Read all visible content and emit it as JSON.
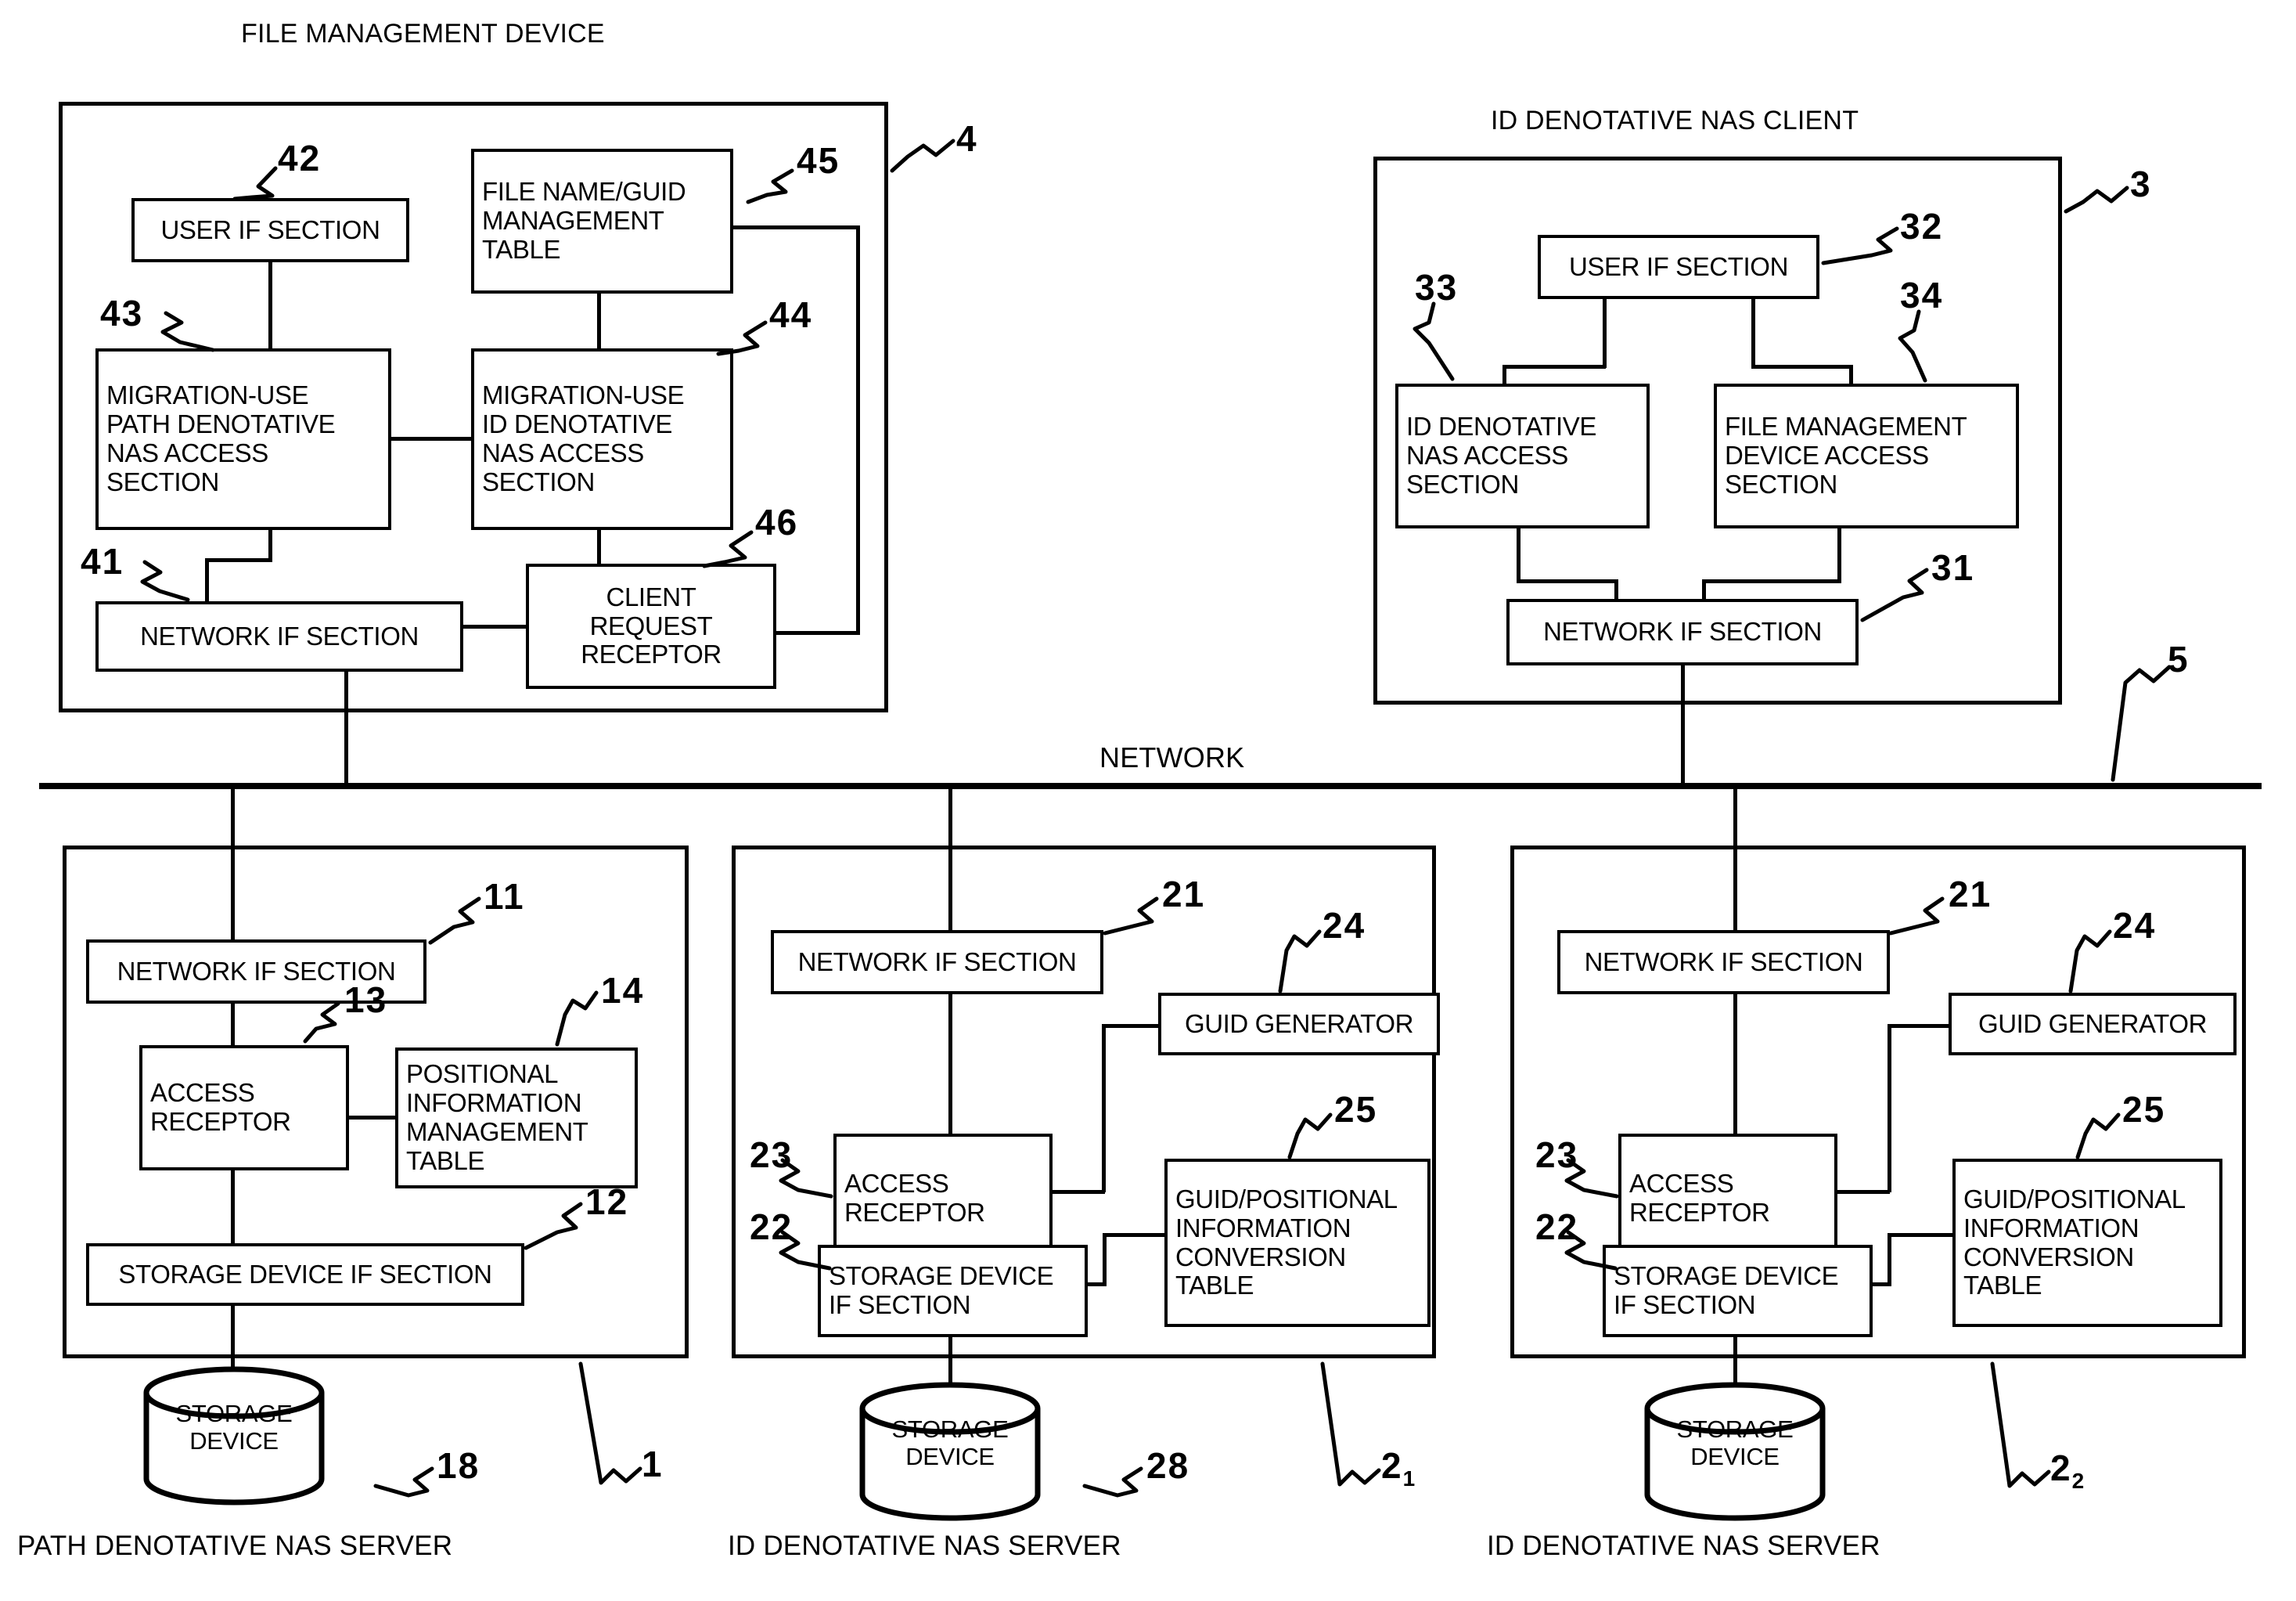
{
  "figure": {
    "groups": {
      "file_management_device": {
        "title": "FILE MANAGEMENT DEVICE",
        "ref": "4",
        "blocks": {
          "user_if": {
            "label": "USER IF SECTION",
            "ref": "42"
          },
          "file_name_guid_table": {
            "label": "FILE NAME/GUID\nMANAGEMENT\nTABLE",
            "ref": "45"
          },
          "migration_path_nas": {
            "label": "MIGRATION-USE\nPATH DENOTATIVE\nNAS ACCESS\nSECTION",
            "ref": "43"
          },
          "migration_id_nas": {
            "label": "MIGRATION-USE\nID DENOTATIVE\nNAS ACCESS\nSECTION",
            "ref": "44"
          },
          "network_if": {
            "label": "NETWORK IF SECTION",
            "ref": "41"
          },
          "client_request_receptor": {
            "label": "CLIENT\nREQUEST\nRECEPTOR",
            "ref": "46"
          }
        }
      },
      "id_denotative_nas_client": {
        "title": "ID DENOTATIVE NAS CLIENT",
        "ref": "3",
        "blocks": {
          "user_if": {
            "label": "USER IF SECTION",
            "ref": "32"
          },
          "id_nas_access": {
            "label": "ID DENOTATIVE\nNAS ACCESS\nSECTION",
            "ref": "33"
          },
          "file_mgmt_device_access": {
            "label": "FILE MANAGEMENT\nDEVICE ACCESS\nSECTION",
            "ref": "34"
          },
          "network_if": {
            "label": "NETWORK IF SECTION",
            "ref": "31"
          }
        }
      },
      "path_denotative_nas_server": {
        "caption": "PATH DENOTATIVE NAS SERVER",
        "ref": "1",
        "blocks": {
          "network_if": {
            "label": "NETWORK IF SECTION",
            "ref": "11"
          },
          "access_receptor": {
            "label": "ACCESS\nRECEPTOR",
            "ref": "13"
          },
          "positional_info_table": {
            "label": "POSITIONAL\nINFORMATION\nMANAGEMENT\nTABLE",
            "ref": "14"
          },
          "storage_device_if": {
            "label": "STORAGE DEVICE IF SECTION",
            "ref": "12"
          },
          "storage_device": {
            "label": "STORAGE\nDEVICE",
            "ref": "18"
          }
        }
      },
      "id_denotative_nas_server_1": {
        "caption": "ID DENOTATIVE NAS SERVER",
        "ref": "2",
        "ref_sub": "1",
        "blocks": {
          "network_if": {
            "label": "NETWORK IF SECTION",
            "ref": "21"
          },
          "guid_generator": {
            "label": "GUID GENERATOR",
            "ref": "24"
          },
          "access_receptor": {
            "label": "ACCESS\nRECEPTOR",
            "ref": "23"
          },
          "guid_positional_table": {
            "label": "GUID/POSITIONAL\nINFORMATION\nCONVERSION\nTABLE",
            "ref": "25"
          },
          "storage_device_if": {
            "label": "STORAGE DEVICE\nIF SECTION",
            "ref": "22"
          },
          "storage_device": {
            "label": "STORAGE\nDEVICE",
            "ref": "28"
          }
        }
      },
      "id_denotative_nas_server_2": {
        "caption": "ID DENOTATIVE NAS SERVER",
        "ref": "2",
        "ref_sub": "2",
        "blocks": {
          "network_if": {
            "label": "NETWORK IF SECTION",
            "ref": "21"
          },
          "guid_generator": {
            "label": "GUID GENERATOR",
            "ref": "24"
          },
          "access_receptor": {
            "label": "ACCESS\nRECEPTOR",
            "ref": "23"
          },
          "guid_positional_table": {
            "label": "GUID/POSITIONAL\nINFORMATION\nCONVERSION\nTABLE",
            "ref": "25"
          },
          "storage_device_if": {
            "label": "STORAGE DEVICE\nIF SECTION",
            "ref": "22"
          },
          "storage_device": {
            "label": "STORAGE\nDEVICE",
            "ref": ""
          }
        }
      }
    },
    "network": {
      "label": "NETWORK",
      "ref": "5"
    }
  }
}
